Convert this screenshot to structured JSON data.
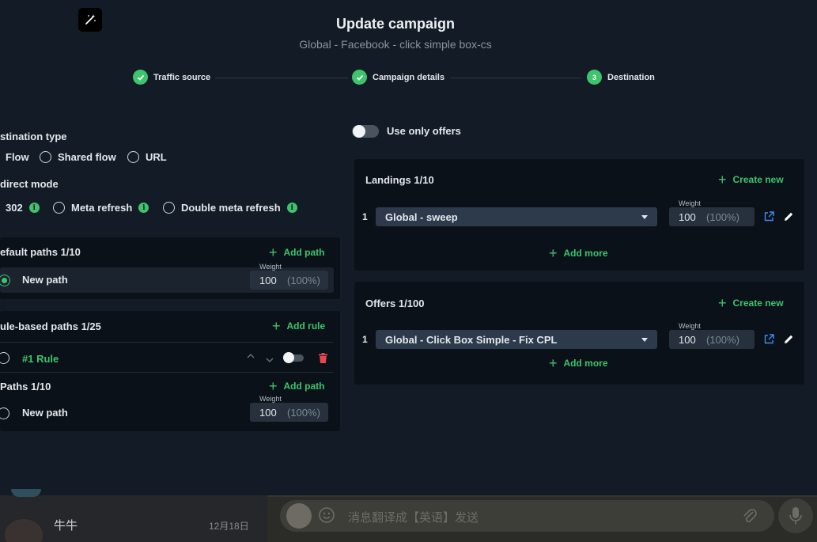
{
  "header": {
    "title": "Update campaign",
    "subtitle": "Global - Facebook - click simple box-cs"
  },
  "steps": [
    {
      "label": "Traffic source",
      "state": "done"
    },
    {
      "label": "Campaign details",
      "state": "done"
    },
    {
      "label": "Destination",
      "state": "current",
      "number": "3"
    }
  ],
  "destination_type": {
    "label": "stination type",
    "options": [
      "Flow",
      "Shared flow",
      "URL"
    ]
  },
  "redirect_mode": {
    "label": "direct mode",
    "options": [
      "302",
      "Meta refresh",
      "Double meta refresh"
    ]
  },
  "use_only_offers": {
    "label": "Use only offers",
    "enabled": false
  },
  "default_paths": {
    "title": "efault paths 1/10",
    "add_label": "Add path",
    "path": {
      "name": "New path",
      "weight_label": "Weight",
      "weight": "100",
      "percent": "(100%)",
      "selected": true
    }
  },
  "rule_paths": {
    "title": "ule-based paths 1/25",
    "add_label": "Add rule",
    "rule": {
      "name": "#1 Rule"
    },
    "paths_title": "Paths 1/10",
    "add_path_label": "Add path",
    "path": {
      "name": "New path",
      "weight_label": "Weight",
      "weight": "100",
      "percent": "(100%)"
    }
  },
  "landings": {
    "title": "Landings 1/10",
    "create_label": "Create new",
    "add_more": "Add more",
    "items": [
      {
        "index": "1",
        "name": "Global - sweep",
        "weight_label": "Weight",
        "weight": "100",
        "percent": "(100%)"
      }
    ]
  },
  "offers": {
    "title": "Offers 1/100",
    "create_label": "Create new",
    "add_more": "Add more",
    "items": [
      {
        "index": "1",
        "name": "Global - Click Box Simple - Fix CPL",
        "weight_label": "Weight",
        "weight": "100",
        "percent": "(100%)"
      }
    ]
  },
  "chat": {
    "contact": "牛牛",
    "date": "12月18日",
    "placeholder": "消息翻译成【英语】发送"
  },
  "colors": {
    "accent": "#3ec46d",
    "background": "#131c26",
    "card": "#0b1118",
    "danger": "#e5484d",
    "link_icon": "#3b8cf0"
  }
}
